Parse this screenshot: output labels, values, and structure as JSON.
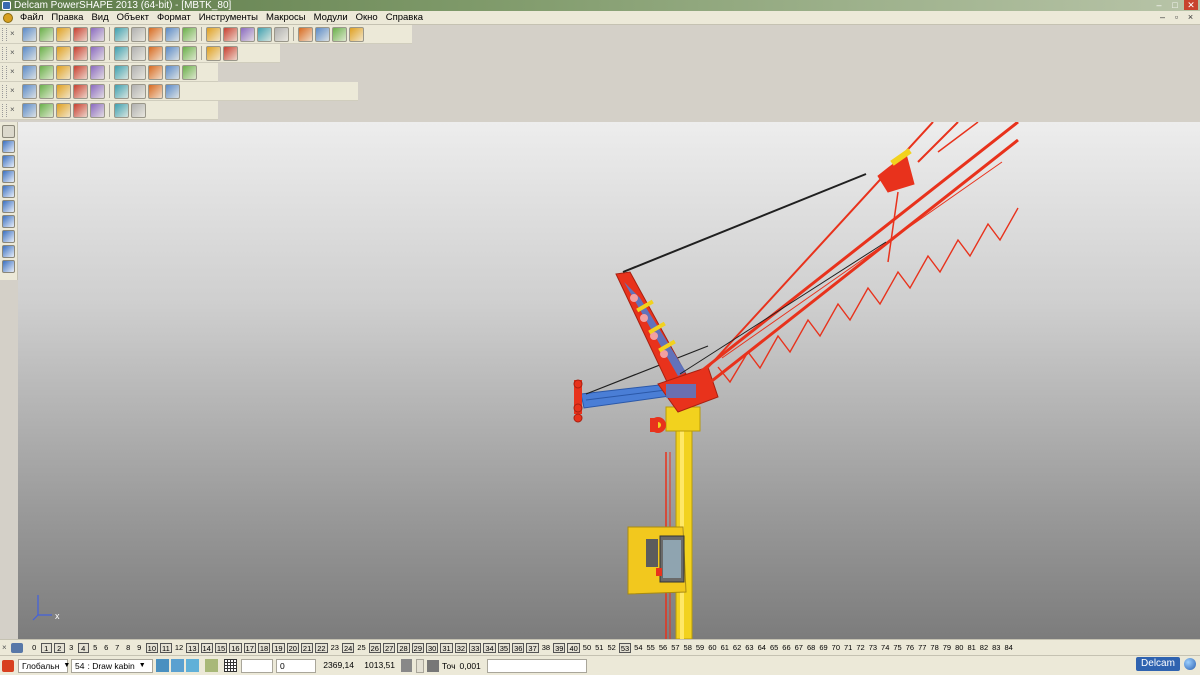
{
  "window": {
    "title": "Delcam PowerSHAPE 2013 (64-bit) - [MBTK_80]",
    "buttons": [
      "–",
      "□",
      "✕"
    ],
    "mdi_buttons": [
      "–",
      "▫",
      "×"
    ]
  },
  "menu": {
    "items": [
      "Файл",
      "Правка",
      "Вид",
      "Объект",
      "Формат",
      "Инструменты",
      "Макросы",
      "Модули",
      "Окно",
      "Справка"
    ]
  },
  "toolbars": {
    "row1_icons": [
      "new-icon",
      "open-icon",
      "save-icon",
      "print-icon",
      "cut-icon",
      "copy-icon",
      "paste-icon",
      "delete-icon",
      "undo-icon",
      "redo-icon",
      "select-icon",
      "rectangle-icon",
      "circle-icon",
      "arc-icon",
      "text-icon",
      "wireframe-icon",
      "surface-icon",
      "solid-icon",
      "tools-icon"
    ],
    "row2_icons": [
      "view-iso-icon",
      "view-front-icon",
      "view-top-icon",
      "zoom-in-icon",
      "zoom-out-icon",
      "zoom-fit-icon",
      "pan-icon",
      "rotate-icon",
      "globe-icon",
      "shade-icon",
      "render-icon",
      "lightbulb-icon"
    ],
    "row3_icons": [
      "layer-icon",
      "doc-icon",
      "cube-icon",
      "sphere-icon",
      "cone-icon",
      "play-icon",
      "box-icon",
      "frame-icon",
      "refresh-icon",
      "arrow-icon"
    ],
    "row4_icons": [
      "extrude-icon",
      "revolve-icon",
      "sweep-icon",
      "loft-icon",
      "fillet-icon",
      "chamfer-icon",
      "shell-icon",
      "boolean-icon",
      "mirror-icon"
    ],
    "row5_icons": [
      "feature-icon",
      "transform-icon",
      "assembly-icon",
      "component-icon",
      "mesh-icon",
      "analysis-icon",
      "drawing-icon"
    ]
  },
  "left_tools": [
    "select-icon",
    "layers-icon",
    "line-icon",
    "polyline-icon",
    "rectangle-icon",
    "polygon-icon",
    "solid-icon",
    "dimension-icon",
    "curve-icon",
    "corner-icon"
  ],
  "viewport": {
    "axis_label": "x"
  },
  "levels": {
    "values": [
      "0",
      "1",
      "2",
      "3",
      "4",
      "5",
      "6",
      "7",
      "8",
      "9",
      "10",
      "11",
      "12",
      "13",
      "14",
      "15",
      "16",
      "17",
      "18",
      "19",
      "20",
      "21",
      "22",
      "23",
      "24",
      "25",
      "26",
      "27",
      "28",
      "29",
      "30",
      "31",
      "32",
      "33",
      "34",
      "35",
      "36",
      "37",
      "38",
      "39",
      "40",
      "50",
      "51",
      "52",
      "53",
      "54",
      "55",
      "56",
      "57",
      "58",
      "59",
      "60",
      "61",
      "62",
      "63",
      "64",
      "65",
      "66",
      "67",
      "68",
      "69",
      "70",
      "71",
      "72",
      "73",
      "74",
      "75",
      "76",
      "77",
      "78",
      "79",
      "80",
      "81",
      "82",
      "83",
      "84"
    ],
    "boxed": [
      "1",
      "2",
      "4",
      "10",
      "11",
      "13",
      "14",
      "15",
      "16",
      "17",
      "18",
      "19",
      "20",
      "21",
      "22",
      "24",
      "26",
      "27",
      "28",
      "29",
      "30",
      "31",
      "32",
      "33",
      "34",
      "35",
      "36",
      "37",
      "39",
      "40",
      "53"
    ]
  },
  "status": {
    "workplane": "Глобальн",
    "level_number": "54",
    "level_name": ": Draw kabin",
    "field_value": "0",
    "coord_x": "2369,14",
    "coord_y": "1013,51",
    "tolerance_label": "Точ",
    "tolerance_value": "0,001",
    "brand": "Delcam"
  },
  "colors": {
    "crane_red": "#e8321c",
    "crane_yellow": "#f2d21e",
    "crane_blue": "#4a7ed6",
    "cable": "#202020"
  }
}
